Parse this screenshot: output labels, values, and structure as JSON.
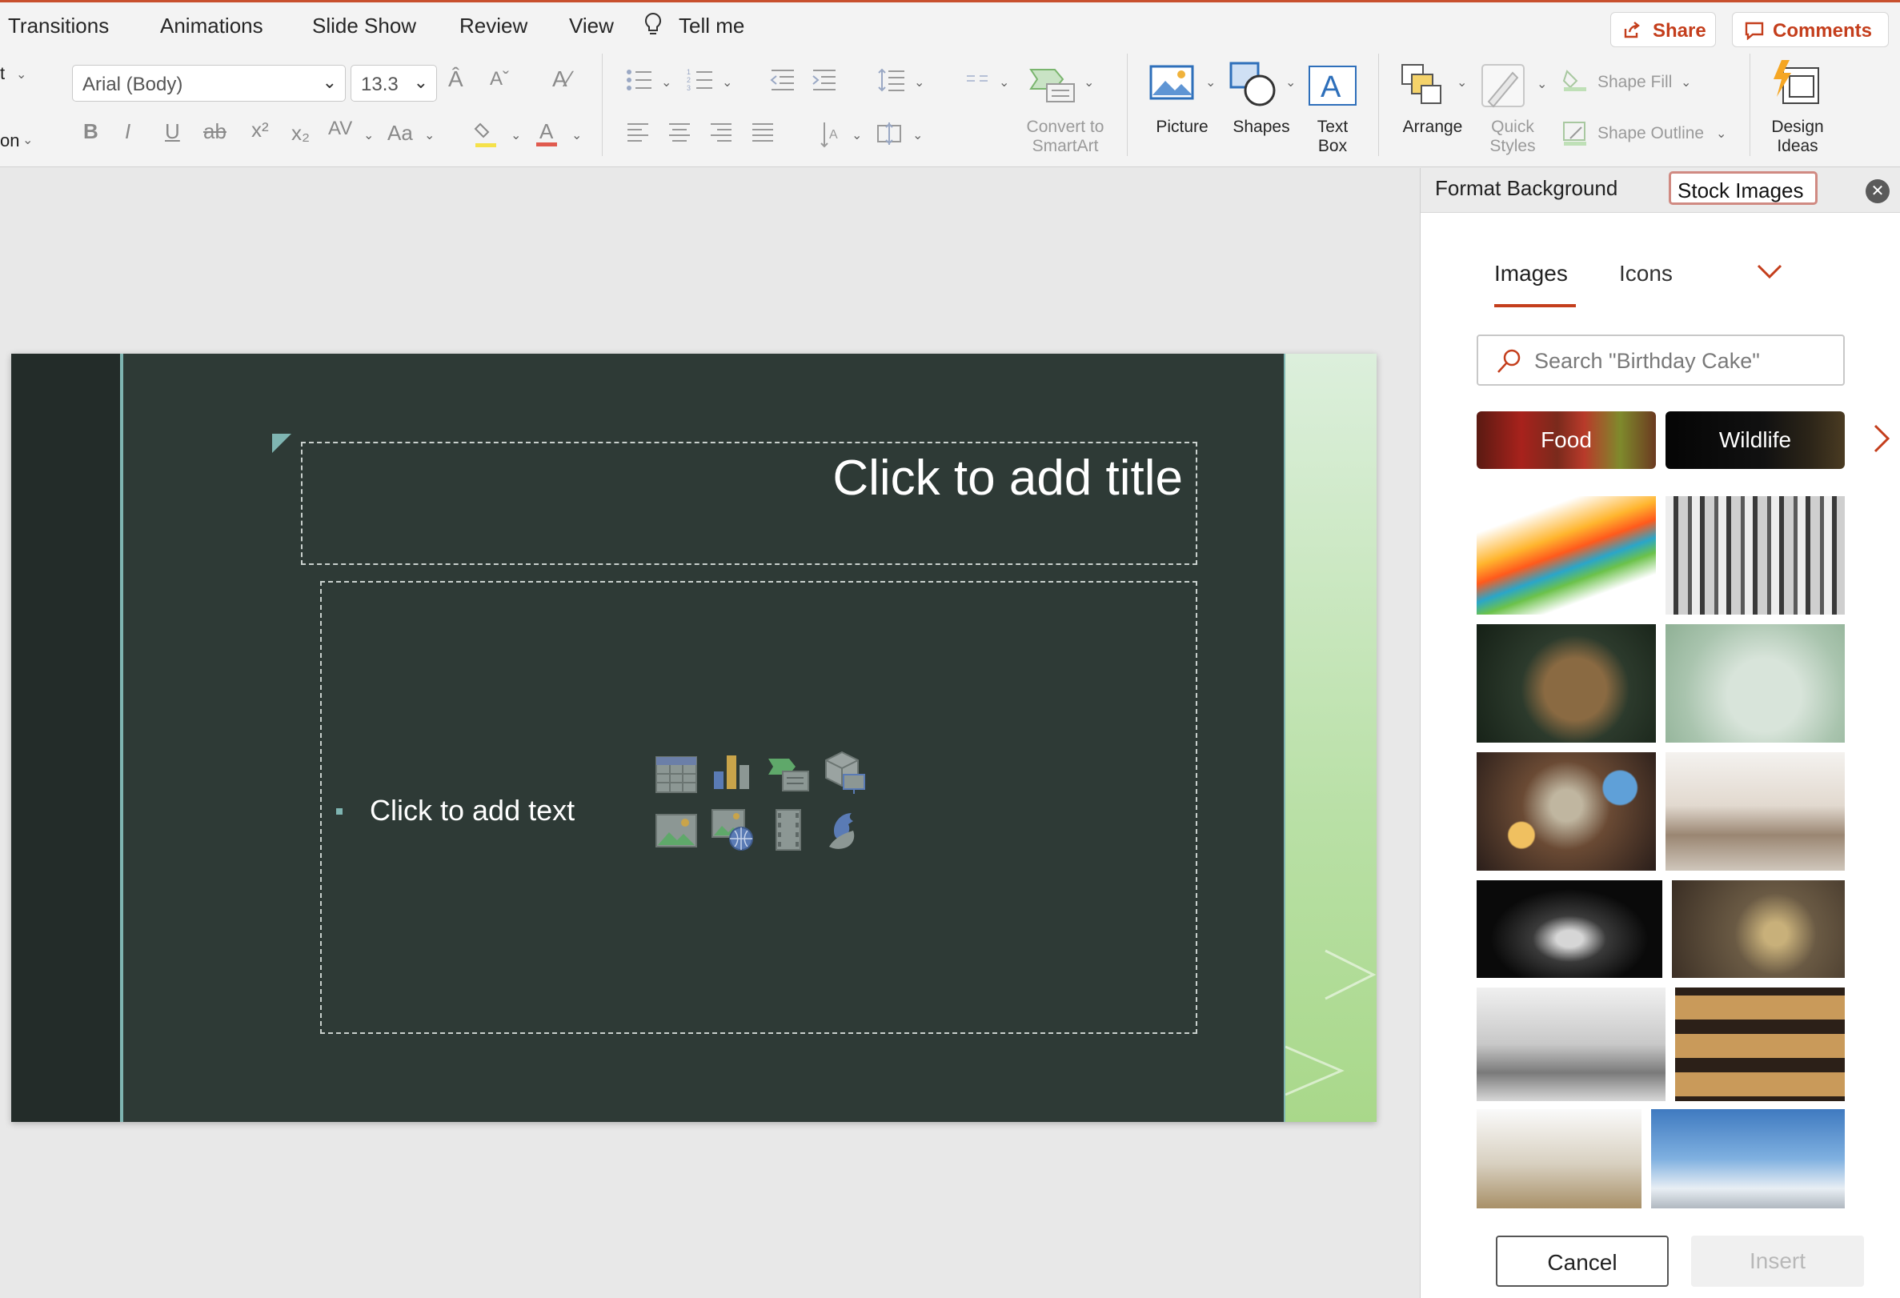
{
  "menu": {
    "tabs": [
      "Transitions",
      "Animations",
      "Slide Show",
      "Review",
      "View"
    ],
    "tell_me": "Tell me",
    "share": "Share",
    "comments": "Comments"
  },
  "ribbon": {
    "layout_trunc": "t",
    "section_trunc": "on",
    "font": "Arial (Body)",
    "font_size": "13.3",
    "picture": "Picture",
    "shapes": "Shapes",
    "text_box": "Text Box",
    "convert_smartart": "Convert to SmartArt",
    "arrange": "Arrange",
    "quick_styles": "Quick Styles",
    "shape_fill": "Shape Fill",
    "shape_outline": "Shape Outline",
    "design_ideas": "Design Ideas"
  },
  "slide": {
    "title_placeholder": "Click to add title",
    "body_placeholder": "Click to add text"
  },
  "pane": {
    "tab_format_background": "Format Background",
    "tab_stock_images": "Stock Images",
    "sub_tabs": [
      "Images",
      "Icons"
    ],
    "search_placeholder": "Search \"Birthday Cake\"",
    "categories": [
      "Food",
      "Wildlife"
    ],
    "cancel": "Cancel",
    "insert": "Insert"
  },
  "colors": {
    "accent": "#c43e1c",
    "slide_bg": "#2e3a36",
    "slide_accent": "#7fb5b2"
  }
}
